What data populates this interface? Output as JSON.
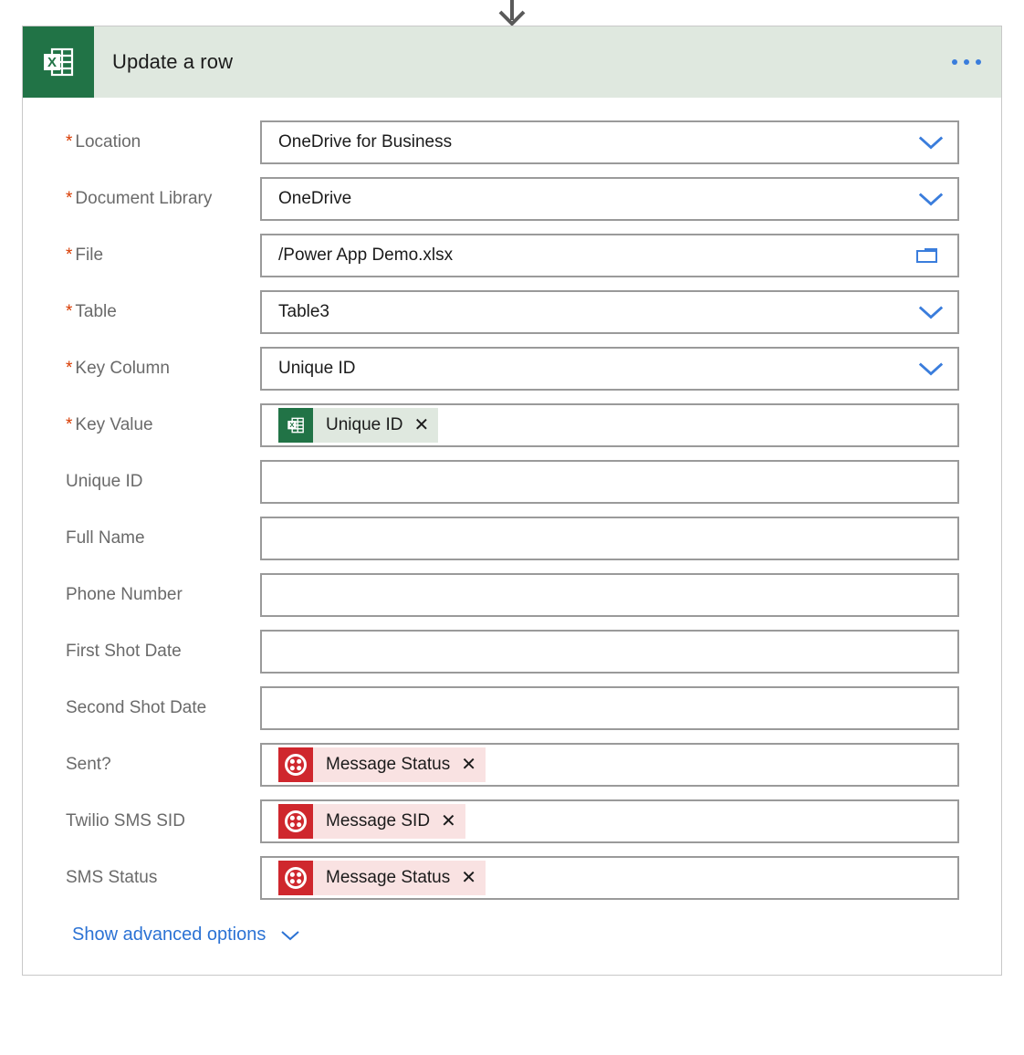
{
  "connector": {
    "arrow_icon": "arrow-down-icon"
  },
  "header": {
    "title": "Update a row",
    "icon": "excel-icon",
    "overflow_icon": "ellipsis-icon",
    "accent_green": "#217346",
    "header_bg": "#dfe8df",
    "menu_dot_color": "#3a7ddc"
  },
  "colors": {
    "required_asterisk": "#d83b01",
    "link_blue": "#2b72d4",
    "chevron_blue": "#3a7ddc",
    "twilio_red": "#cf272d",
    "excel_green": "#217346"
  },
  "fields": [
    {
      "label": "Location",
      "required": true,
      "required_mark": "*",
      "value": "OneDrive for Business",
      "control": "dropdown",
      "icon": "chevron-down-icon"
    },
    {
      "label": "Document Library",
      "required": true,
      "required_mark": "*",
      "value": "OneDrive",
      "control": "dropdown",
      "icon": "chevron-down-icon"
    },
    {
      "label": "File",
      "required": true,
      "required_mark": "*",
      "value": "/Power App Demo.xlsx",
      "control": "filepicker",
      "icon": "folder-icon"
    },
    {
      "label": "Table",
      "required": true,
      "required_mark": "*",
      "value": "Table3",
      "control": "dropdown",
      "icon": "chevron-down-icon"
    },
    {
      "label": "Key Column",
      "required": true,
      "required_mark": "*",
      "value": "Unique ID",
      "control": "dropdown",
      "icon": "chevron-down-icon"
    },
    {
      "label": "Key Value",
      "required": true,
      "required_mark": "*",
      "value": "",
      "control": "token",
      "token": {
        "text": "Unique ID",
        "source": "excel",
        "icon": "excel-icon",
        "remove": "✕"
      }
    },
    {
      "label": "Unique ID",
      "required": false,
      "value": "",
      "control": "text"
    },
    {
      "label": "Full Name",
      "required": false,
      "value": "",
      "control": "text"
    },
    {
      "label": "Phone Number",
      "required": false,
      "value": "",
      "control": "text"
    },
    {
      "label": "First Shot Date",
      "required": false,
      "value": "",
      "control": "text"
    },
    {
      "label": "Second Shot Date",
      "required": false,
      "value": "",
      "control": "text"
    },
    {
      "label": "Sent?",
      "required": false,
      "value": "",
      "control": "token",
      "token": {
        "text": "Message Status",
        "source": "twilio",
        "icon": "twilio-icon",
        "remove": "✕"
      }
    },
    {
      "label": "Twilio SMS SID",
      "required": false,
      "value": "",
      "control": "token",
      "token": {
        "text": "Message SID",
        "source": "twilio",
        "icon": "twilio-icon",
        "remove": "✕"
      }
    },
    {
      "label": "SMS Status",
      "required": false,
      "value": "",
      "control": "token",
      "token": {
        "text": "Message Status",
        "source": "twilio",
        "icon": "twilio-icon",
        "remove": "✕"
      }
    }
  ],
  "advanced": {
    "label": "Show advanced options",
    "icon": "chevron-down-icon"
  }
}
